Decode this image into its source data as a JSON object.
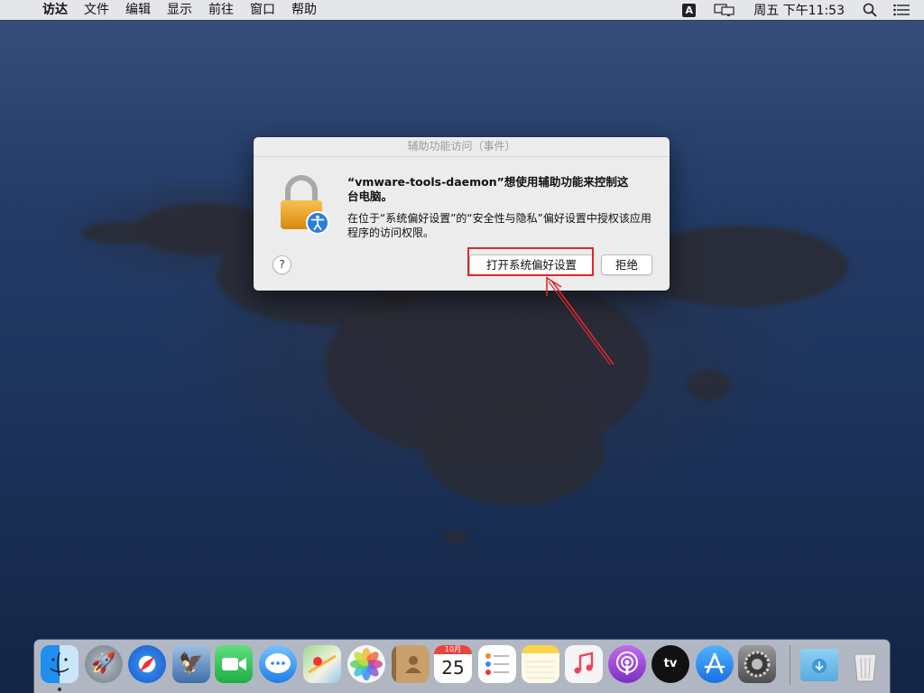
{
  "menubar": {
    "apple_glyph": "",
    "items": [
      "访达",
      "文件",
      "编辑",
      "显示",
      "前往",
      "窗口",
      "帮助"
    ],
    "input_source": "A",
    "clock": "周五 下午11:53"
  },
  "dialog": {
    "title": "辅助功能访问（事件）",
    "message_title": "“vmware-tools-daemon”想使用辅助功能来控制这台电脑。",
    "message_body": "在位于“系统偏好设置”的“安全性与隐私”偏好设置中授权该应用程序的访问权限。",
    "help_label": "?",
    "open_prefs_label": "打开系统偏好设置",
    "deny_label": "拒绝"
  },
  "calendar": {
    "month": "10月",
    "day": "25"
  },
  "dock": {
    "apps": [
      {
        "name": "finder-icon",
        "color": "#3aa0f0"
      },
      {
        "name": "launchpad-icon",
        "color": "#8e9aa8"
      },
      {
        "name": "safari-icon",
        "color": "#2f84ea"
      },
      {
        "name": "photo-booth-icon",
        "color": "#5b7fb0"
      },
      {
        "name": "facetime-icon",
        "color": "#2ec75a"
      },
      {
        "name": "messages-icon",
        "color": "#3b9cf5"
      },
      {
        "name": "maps-icon",
        "color": "#7cc47a"
      },
      {
        "name": "photos-icon",
        "color": "#f1f1f1"
      },
      {
        "name": "contacts-icon",
        "color": "#b38b5a"
      },
      {
        "name": "calendar-icon",
        "color": "#ffffff"
      },
      {
        "name": "reminders-icon",
        "color": "#ffffff"
      },
      {
        "name": "notes-icon",
        "color": "#f7d44c"
      },
      {
        "name": "music-icon",
        "color": "#f5f5f5"
      },
      {
        "name": "podcasts-icon",
        "color": "#9b45d8"
      },
      {
        "name": "apple-tv-icon",
        "color": "#1a1a1a"
      },
      {
        "name": "app-store-icon",
        "color": "#2a8cf0"
      },
      {
        "name": "system-preferences-icon",
        "color": "#6c6c6c"
      },
      {
        "name": "downloads-folder-icon",
        "color": "#76bfe8"
      },
      {
        "name": "trash-icon",
        "color": "#d8d8d8"
      }
    ]
  }
}
